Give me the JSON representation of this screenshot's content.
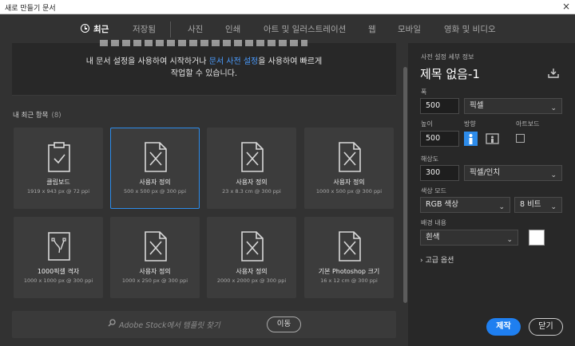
{
  "window": {
    "title": "새로 만들기 문서",
    "close_glyph": "×"
  },
  "tabs": [
    {
      "label": "최근",
      "active": true
    },
    {
      "label": "저장됨"
    },
    {
      "label": "사진"
    },
    {
      "label": "인쇄"
    },
    {
      "label": "아트 및 일러스트레이션"
    },
    {
      "label": "웹"
    },
    {
      "label": "모바일"
    },
    {
      "label": "영화 및 비디오"
    }
  ],
  "banner": {
    "line1_a": "내 문서 설정을 사용하여 시작하거나 ",
    "line1_link": "문서 사전 설정",
    "line1_b": "을 사용하여 빠르게",
    "line2": "작업할 수 있습니다."
  },
  "recent": {
    "heading": "내 최근 항목",
    "count": "(8)"
  },
  "cards": [
    {
      "name": "클립보드",
      "meta": "1919 x 943 px @ 72 ppi",
      "icon": "clipboard-icon"
    },
    {
      "name": "사용자 정의",
      "meta": "500 x 500 px @ 300 ppi",
      "icon": "document-custom-icon",
      "selected": true
    },
    {
      "name": "사용자 정의",
      "meta": "23 x 8.3 cm @ 300 ppi",
      "icon": "document-custom-icon"
    },
    {
      "name": "사용자 정의",
      "meta": "1000 x 500 px @ 300 ppi",
      "icon": "document-custom-icon"
    },
    {
      "name": "1000픽셀 격자",
      "meta": "1000 x 1000 px @ 300 ppi",
      "icon": "grid-document-icon"
    },
    {
      "name": "사용자 정의",
      "meta": "1000 x 250 px @ 300 ppi",
      "icon": "document-custom-icon"
    },
    {
      "name": "사용자 정의",
      "meta": "2000 x 2000 px @ 300 ppi",
      "icon": "document-custom-icon"
    },
    {
      "name": "기본 Photoshop 크기",
      "meta": "16 x 12 cm @ 300 ppi",
      "icon": "document-custom-icon"
    }
  ],
  "search": {
    "placeholder": "Adobe Stock에서 템플릿 찾기",
    "button": "이동"
  },
  "preset": {
    "header": "사전 설정 세부 정보",
    "name": "제목 없음-1",
    "width_label": "폭",
    "width_value": "500",
    "width_unit": "픽셀",
    "height_label": "높이",
    "height_value": "500",
    "orientation_label": "방향",
    "artboard_label": "아트보드",
    "resolution_label": "해상도",
    "resolution_value": "300",
    "resolution_unit": "픽셀/인치",
    "color_mode_label": "색상 모드",
    "color_mode_value": "RGB 색상",
    "bit_depth_value": "8 비트",
    "background_label": "배경 내용",
    "background_value": "흰색",
    "background_color": "#ffffff",
    "advanced_label": "고급 옵션"
  },
  "buttons": {
    "create": "제작",
    "close": "닫기"
  },
  "colors": {
    "accent": "#1f7ff0",
    "link": "#4b9cff"
  }
}
